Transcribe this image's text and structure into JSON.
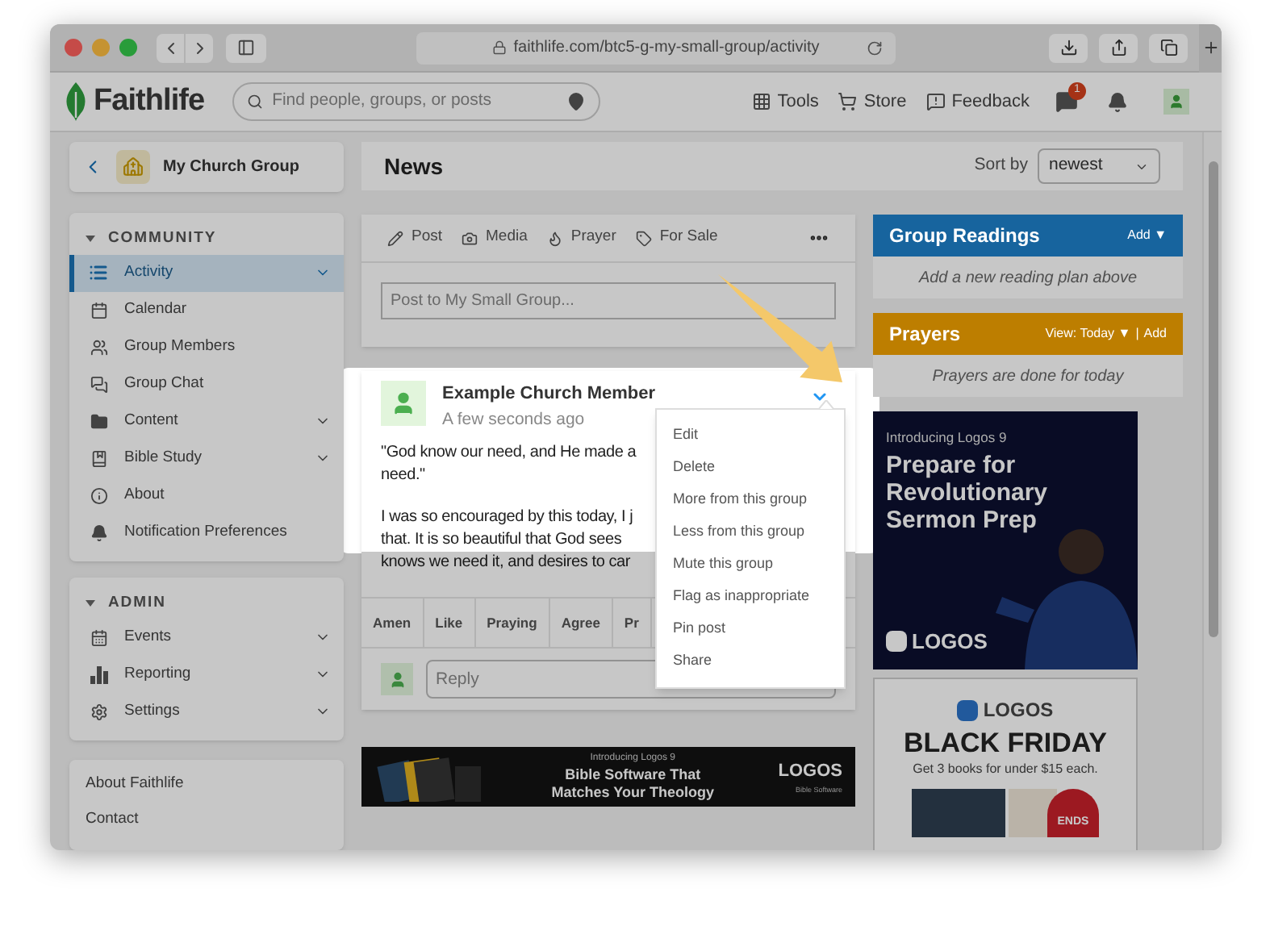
{
  "browser": {
    "url": "faithlife.com/btc5-g-my-small-group/activity"
  },
  "header": {
    "logo": "Faithlife",
    "search": {
      "placeholder": "Find people, groups, or posts"
    },
    "nav": [
      "Tools",
      "Store",
      "Feedback"
    ],
    "messages_badge": "1"
  },
  "sidebar": {
    "group": {
      "name": "My Church Group"
    },
    "sections": [
      {
        "title": "COMMUNITY",
        "items": [
          {
            "label": "Activity",
            "selected": true,
            "expandable": true
          },
          {
            "label": "Calendar",
            "selected": false,
            "expandable": false
          },
          {
            "label": "Group Members",
            "selected": false,
            "expandable": false
          },
          {
            "label": "Group Chat",
            "selected": false,
            "expandable": false
          },
          {
            "label": "Content",
            "selected": false,
            "expandable": true
          },
          {
            "label": "Bible Study",
            "selected": false,
            "expandable": true
          },
          {
            "label": "About",
            "selected": false,
            "expandable": false
          },
          {
            "label": "Notification Preferences",
            "selected": false,
            "expandable": false
          }
        ]
      },
      {
        "title": "ADMIN",
        "items": [
          {
            "label": "Events",
            "selected": false,
            "expandable": true
          },
          {
            "label": "Reporting",
            "selected": false,
            "expandable": true
          },
          {
            "label": "Settings",
            "selected": false,
            "expandable": true
          }
        ]
      }
    ],
    "footer_links": [
      "About Faithlife",
      "Contact"
    ]
  },
  "news": {
    "title": "News",
    "sort_label": "Sort by",
    "sort_value": "newest"
  },
  "composer": {
    "actions": [
      "Post",
      "Media",
      "Prayer",
      "For Sale"
    ],
    "placeholder": "Post to My Small Group..."
  },
  "post": {
    "author": "Example Church Member",
    "time": "A few seconds ago",
    "paragraphs": [
      [
        "\"God know our need, and He made a",
        "need.\""
      ],
      [
        "I was so encouraged by this today, I j",
        "that. It is so beautiful that God sees",
        "knows we need it, and desires to car"
      ]
    ],
    "reactions": [
      "Amen",
      "Like",
      "Praying",
      "Agree",
      "Pr"
    ],
    "reply_placeholder": "Reply"
  },
  "post_menu": {
    "items": [
      "Edit",
      "Delete",
      "More from this group",
      "Less from this group",
      "Mute this group",
      "Flag as inappropriate",
      "Pin post",
      "Share"
    ]
  },
  "banner_ad": {
    "kicker": "Introducing Logos 9",
    "headline": [
      "Bible Software That",
      "Matches Your Theology"
    ],
    "brand": "LOGOS",
    "brand_sub": "Bible Software"
  },
  "widgets": [
    {
      "title": "Group Readings",
      "color": "#17649e",
      "links": [
        "Add ▼"
      ],
      "body": "Add a new reading plan above"
    },
    {
      "title": "Prayers",
      "color": "#bd7e00",
      "links": [
        "View: Today ▼",
        "Add"
      ],
      "separator": "|",
      "body": "Prayers are done for today"
    }
  ],
  "ad_sermon": {
    "kicker": "Introducing Logos 9",
    "headline": "Prepare for Revolutionary Sermon Prep",
    "brand": "LOGOS"
  },
  "ad_black_friday": {
    "brand": "LOGOS",
    "headline": "BLACK FRIDAY",
    "subline": "Get 3 books for under $15 each.",
    "badge": "ENDS"
  }
}
